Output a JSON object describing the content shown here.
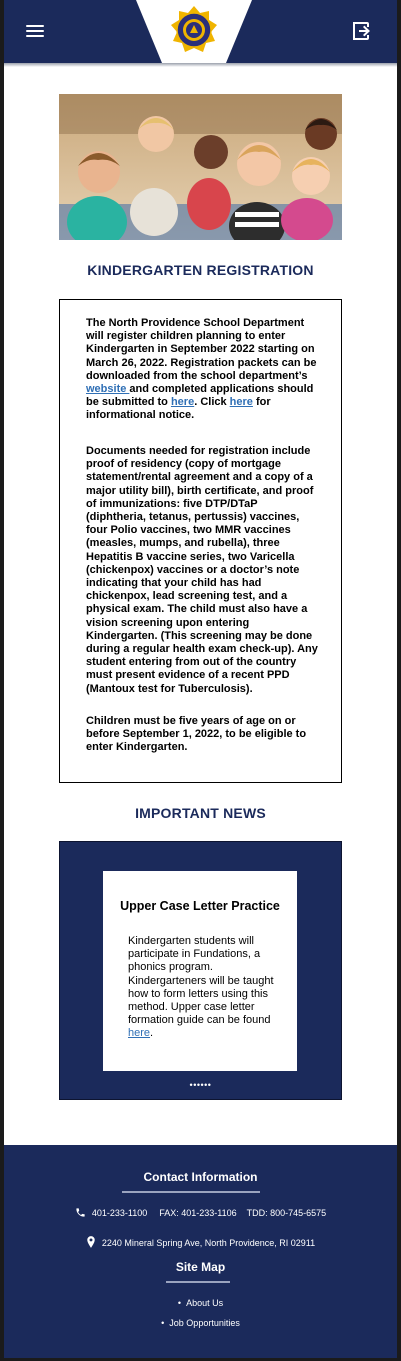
{
  "header": {
    "menu_icon": "hamburger-menu-icon",
    "logo_icon": "school-seal-logo",
    "login_icon": "sign-in-icon",
    "brand_color": "#1b2a5b"
  },
  "registration": {
    "title": "KINDERGARTEN REGISTRATION",
    "p1_text": "The North Providence School Department will register children planning to enter Kindergarten in September 2022 starting on March 26, 2022. Registration packets can be downloaded from the school department’s ",
    "p1_link1": "website ",
    "p1_mid": " and completed applications should be submitted to ",
    "p1_link2": "here",
    "p1_mid2": ". Click ",
    "p1_link3": "here",
    "p1_end": " for informational notice.",
    "p2": "Documents needed for registration include proof of residency (copy of mortgage statement/rental agreement and a copy of a major utility bill), birth certificate, and proof of immunizations: five DTP/DTaP (diphtheria, tetanus, pertussis) vaccines, four Polio vaccines, two MMR vaccines (measles, mumps, and rubella), three Hepatitis B vaccine series, two Varicella (chickenpox) vaccines or a doctor’s note indicating that your child has had chickenpox, lead screening test, and a physical exam.  The child must also have a vision screening upon entering Kindergarten. (This screening may be done during a regular health exam check-up).  Any student entering from out of the country must present evidence of a recent PPD (Mantoux test for Tuberculosis).",
    "p3": "Children must be five years of age on or before September 1, 2022, to be eligible to enter Kindergarten."
  },
  "news": {
    "title": "IMPORTANT NEWS",
    "card_title": "Upper Case Letter Practice",
    "card_body": "Kindergarten students will participate in Fundations, a phonics program. Kindergarteners will be taught how to form letters using this method. Upper case letter formation guide can be found ",
    "card_link": "here",
    "card_end": ".",
    "pager": "••••••"
  },
  "footer": {
    "contact_title": "Contact Information",
    "phone": "401-233-1100",
    "fax": "FAX: 401-233-1106",
    "tdd": "TDD: 800-745-6575",
    "address": "2240 Mineral Spring Ave, North Providence, RI 02911",
    "sitemap_title": "Site Map",
    "links": [
      "About Us",
      "Job Opportunities"
    ]
  }
}
